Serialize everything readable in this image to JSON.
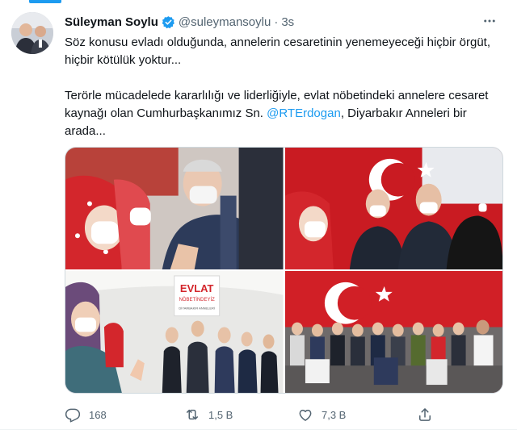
{
  "tweet": {
    "author_name": "Süleyman Soylu",
    "handle": "@suleymansoylu",
    "separator": "·",
    "time": "3s",
    "paragraphs": [
      "Söz konusu evladı olduğunda, annelerin cesaretinin yenemeyeceği hiçbir örgüt, hiçbir kötülük yoktur...",
      ""
    ],
    "p2_before": "Terörle mücadelede kararlılığı ve liderliğiyle, evlat nöbetindeki annelere cesaret kaynağı olan Cumhurbaşkanımız Sn. ",
    "p2_mention": "@RTErdogan",
    "p2_after": ", Diyarbakır Anneleri bir arada..."
  },
  "media": {
    "photos": [
      {
        "name": "photo-mother-handshake"
      },
      {
        "name": "photo-tent-gathering"
      },
      {
        "name": "photo-evlat-sign",
        "sign_title": "EVLAT",
        "sign_subtitle": "NÖBETİNDEYİZ",
        "sign_small": "DİYARBAKIR ANNELERİ"
      },
      {
        "name": "photo-group-flag"
      }
    ]
  },
  "actions": {
    "reply_count": "168",
    "retweet_count": "1,5 B",
    "like_count": "7,3 B"
  },
  "colors": {
    "accent": "#1d9bf0",
    "text": "#0f1419",
    "muted": "#536471",
    "flag_red": "#d91c23"
  },
  "icons": [
    "verified-badge-icon",
    "more-icon",
    "reply-icon",
    "retweet-icon",
    "like-icon",
    "share-icon"
  ]
}
